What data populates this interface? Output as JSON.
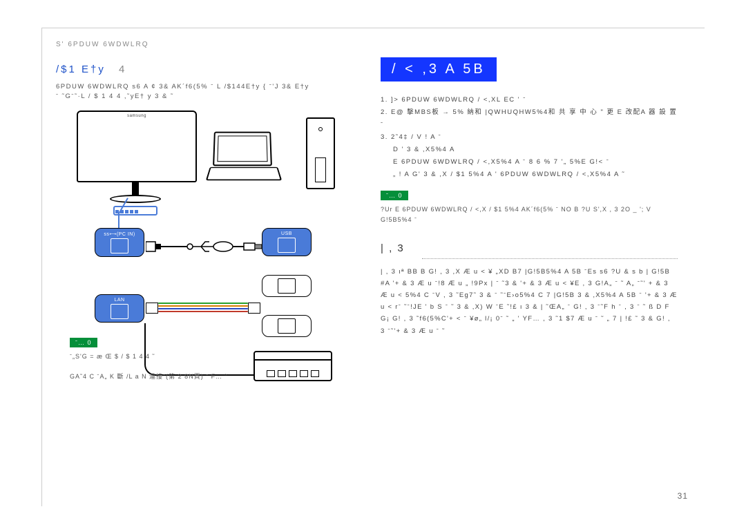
{
  "breadcrumb": "S' 6PDUW 6WDWLRQ",
  "left": {
    "title_main": "/$1 E†y",
    "title_num": "4",
    "intro_line1": "6PDUW 6WDWLRQ s6 A ¢ 3& AK´f6(5% ˉ L   /$144E†y  { ˉ'J  3& E†y",
    "intro_line2": "ˉ ˜Gˉ˜·L    / $ 1 4 4 ,˜yE† y   3 & ˜"
  },
  "diagram_labels": {
    "pc_in": "ss⟷(PC IN)",
    "usb": "USB",
    "lan": "LAN"
  },
  "left_notes": {
    "tag": "ˉ… 0",
    "line1": "ˉ„S'G = æ Œ $    / $ 1 4 4 ˜",
    "line2": "  GA˜4  C ˉA„ K        斷 /L a N 連接ˉ(第 2 8N頁) ˉ  F…  ˜"
  },
  "right": {
    "banner": "/ < ,3 A 5B",
    "step1": "1. ]>  6PDUW 6WDWLRQ  / <,XL EC ' ˉ",
    "step2": "2. E@ 擊MBS板 → 5% 納和 |QWHUQHW5%4和 共 享 中 心  \"   更 E 改配A 器 設 置 ˉ",
    "step3": "3. 2˜4‡   / V ! A  ˉ",
    "step3a": "D  '   3 &  ,X5%4 A",
    "step3b": "E   6PDUW 6WDWLRQ  / <,X5%4 A  ˉ 8 6 % 7 '„ 5%E G!< ˉ",
    "step3c": "„ ! A  G'   3 &  ,X / $1 5%4 A  '  6PDUW 6WDWLRQ  / <,X5%4 A  ˜",
    "note_tag": "ˉ… 0",
    "note_line": "?Ur E   6PDUW 6WDWLRQ  / <,X / $1 5%4 AK´f6(5% ˉ NO B ?U S',X  , 3 2O _  '; V G!5B5%4 ˉ",
    "sub_heading": "|   , 3",
    "body": "|   , 3   ıª BB B G!   , 3    ,X Æ u < ¥ „XD B7 |G!5B5%4 A 5B ˉEs s6 ?U & s b  |    G!5B #A   '+ & 3  Æ u ˉ!8 Æ u   „  !9Px  | ˉ ˜3 &       '+ & 3 Æ u < ¥E   , 3    G!A„ ˉ  ˜  A„   ˉ˜' + & 3  Æ u < 5%4  C ˉV   , 3   ˜Eg7˜ 3 & ˉ ˜ˉE›o5%4  C 7 |G!5B  3 &  ,X5%4 A 5B ˉ '+ & 3 Æ u <   rˉ ˜ˉ!JE ' b S ˉ  ˜ 3 &  ,X) W ˉE  ˜!£ ı  3 &   | ˜ŒA„ ˉ G!   , 3     ˉ˜F h ˉ   , 3   ˉ  ˜ ß D  F G¡ G!    , 3   ˜f6(5%C'+ < ˉ ¥ø„ l/¡ 0ˉ ˜  „ ' YF…   , 3 ˜1 $7 Æ u ˉ ˜ „ 7 | !£ ˜  3 & G!   , 3   ˉ˜'+ & 3 Æ u ˉ ˜"
  },
  "page_number": "31"
}
